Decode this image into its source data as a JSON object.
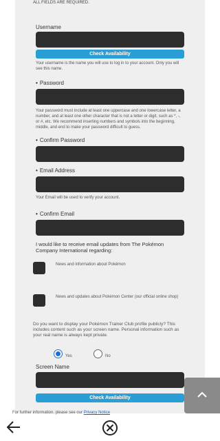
{
  "form": {
    "required_note": "ALL FIELDS ARE REQUIRED.",
    "username": {
      "label": "Username",
      "check_button": "Check Availability",
      "help": "Your username is the name you will use to log in to your account. Only you will see this name."
    },
    "password": {
      "label": "Password",
      "help": "Your password must include at least one uppercase and one lowercase letter, a number, and at least one other character that is not a letter or digit, such as *, -, or #, etc. We recommend inserting numbers and symbols into the beginning, middle, and end to make your password difficult to guess."
    },
    "confirm_password": {
      "label": "Confirm Password"
    },
    "email": {
      "label": "Email Address",
      "help": "Your Email will be used to verify your account."
    },
    "confirm_email": {
      "label": "Confirm Email"
    },
    "updates": {
      "prompt": "I would like to receive email updates from The Pokémon Company International regarding:",
      "option1": "News and information about Pokémon",
      "option2": "News and updates about Pokémon Center (our official online shop)"
    },
    "public_profile": {
      "question": "Do you want to display your Pokémon Trainer Club profile publicly? This includes content such as your screen name. Personal information such as your real name is always kept private.",
      "yes": "Yes",
      "no": "No",
      "selected": "Yes"
    },
    "screen_name": {
      "label": "Screen Name",
      "check_button": "Check Availability"
    },
    "footer_text": "For further information, please see our",
    "footer_link": "Privacy Notice"
  },
  "icons": {
    "back": "arrow-left-icon",
    "close": "close-circle-icon",
    "scroll_top": "chevron-up-icon"
  },
  "colors": {
    "accent": "#2a9fd6",
    "field_bg": "#2d2d2d",
    "panel_bg": "#efefef"
  }
}
